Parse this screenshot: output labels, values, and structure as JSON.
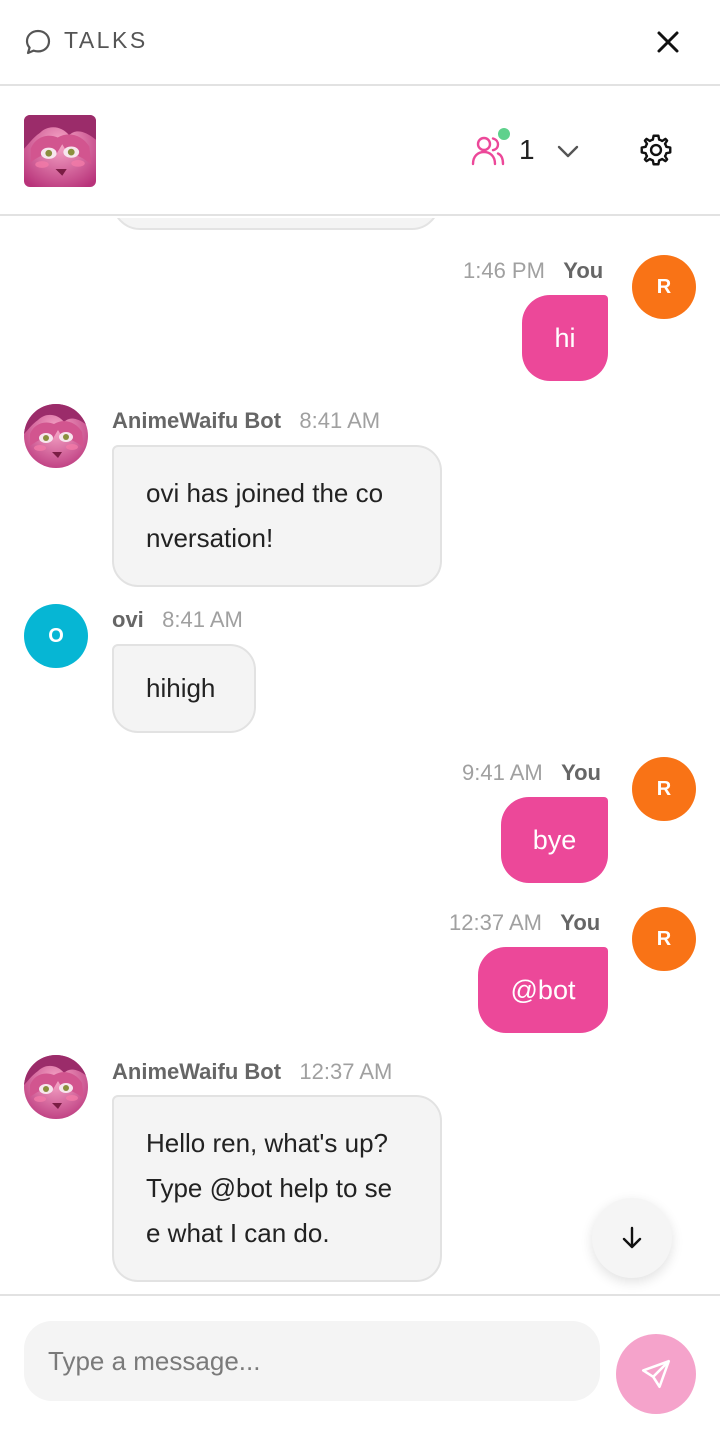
{
  "topbar": {
    "title": "TALKS",
    "talks_icon": "chat-bubble-icon",
    "close_icon": "close-icon"
  },
  "header": {
    "online_count": "1",
    "users_icon": "users-icon",
    "dropdown_icon": "chevron-down-icon",
    "settings_icon": "gear-icon"
  },
  "messages": [
    {
      "direction": "out",
      "sender": "You",
      "time": "1:46 PM",
      "avatar_letter": "R",
      "lines": [
        "hi"
      ]
    },
    {
      "direction": "in",
      "sender": "AnimeWaifu Bot",
      "time": "8:41 AM",
      "avatar": "bot-avatar",
      "lines": [
        "ovi has joined the co",
        "nversation!"
      ]
    },
    {
      "direction": "in",
      "sender": "ovi",
      "time": "8:41 AM",
      "avatar_letter": "O",
      "lines": [
        "hihigh"
      ]
    },
    {
      "direction": "out",
      "sender": "You",
      "time": "9:41 AM",
      "avatar_letter": "R",
      "lines": [
        "bye"
      ]
    },
    {
      "direction": "out",
      "sender": "You",
      "time": "12:37 AM",
      "avatar_letter": "R",
      "lines": [
        "@bot"
      ]
    },
    {
      "direction": "in",
      "sender": "AnimeWaifu Bot",
      "time": "12:37 AM",
      "avatar": "bot-avatar",
      "lines": [
        "Hello ren, what's up?",
        "Type @bot help to se",
        "e what I can do."
      ]
    }
  ],
  "composer": {
    "placeholder": "Type a message...",
    "value": "",
    "send_icon": "send-icon"
  },
  "scroll_down_icon": "arrow-down-icon",
  "colors": {
    "accent": "#ec4899",
    "send_button": "#f5a3cb",
    "user_avatar": "#f97316",
    "ovi_avatar": "#06b6d4",
    "online": "#5ed18c"
  }
}
